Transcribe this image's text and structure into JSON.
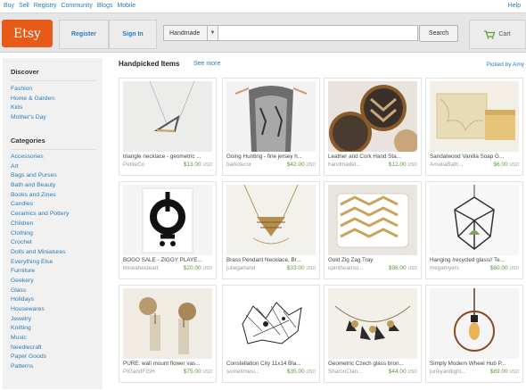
{
  "topnav": {
    "items": [
      "Buy",
      "Sell",
      "Registry",
      "Community",
      "Blogs",
      "Mobile"
    ],
    "help": "Help"
  },
  "header": {
    "logo": "Etsy",
    "register": "Register",
    "signin": "Sign In",
    "search": {
      "category": "Handmade",
      "value": "",
      "button": "Search"
    },
    "cart": "Cart",
    "colors": {
      "logo": "#e55b17",
      "link": "#2b7bb9",
      "price": "#5c9b3a"
    }
  },
  "sidebar": {
    "discover_title": "Discover",
    "discover": [
      "Fashion",
      "Home & Garden",
      "Kids",
      "Mother's Day"
    ],
    "categories_title": "Categories",
    "categories": [
      "Accessories",
      "Art",
      "Bags and Purses",
      "Bath and Beauty",
      "Books and Zines",
      "Candles",
      "Ceramics and Pottery",
      "Children",
      "Clothing",
      "Crochet",
      "Dolls and Miniatures",
      "Everything Else",
      "Furniture",
      "Geekery",
      "Glass",
      "Holidays",
      "Housewares",
      "Jewelry",
      "Knitting",
      "Music",
      "Needlecraft",
      "Paper Goods",
      "Patterns"
    ]
  },
  "main": {
    "title": "Handpicked Items",
    "see_more": "See more",
    "picked_by": "Picked by Amy",
    "items": [
      {
        "title": "triangle necklace - geometric ...",
        "shop": "PetiteCo",
        "price": "$13.00",
        "currency": "USD",
        "icon": "triangle-necklace"
      },
      {
        "title": "Going Hunting - fine jersey h...",
        "shop": "barkdecor",
        "price": "$42.00",
        "currency": "USD",
        "icon": "scarf"
      },
      {
        "title": "Leather and Cork Hand Sta...",
        "shop": "handmadet...",
        "price": "$12.00",
        "currency": "USD",
        "icon": "coasters"
      },
      {
        "title": "Sandalwood Vanilla Soap G...",
        "shop": "AmeliaBath...",
        "price": "$6.00",
        "currency": "USD",
        "icon": "soap"
      },
      {
        "title": "BOGO SALE - ZIGGY PLAYE...",
        "shop": "linneaheideart",
        "price": "$20.00",
        "currency": "USD",
        "icon": "bike-print"
      },
      {
        "title": "Brass Pendant Necklace, Br...",
        "shop": "juliegarland",
        "price": "$33.00",
        "currency": "USD",
        "icon": "brass-necklace"
      },
      {
        "title": "Gold Zig Zag Tray",
        "shop": "upintheairso...",
        "price": "$98.00",
        "currency": "USD",
        "icon": "zigzag-tray"
      },
      {
        "title": "Hanging /recycled glass// Te...",
        "shop": "megamyers",
        "price": "$60.00",
        "currency": "USD",
        "icon": "terrarium"
      },
      {
        "title": "PURE: wall mount flower vas...",
        "shop": "PIGandFISH",
        "price": "$75.00",
        "currency": "USD",
        "icon": "flower-vase"
      },
      {
        "title": "Constellation City 11x14 Bla...",
        "shop": "sometimesi...",
        "price": "$35.00",
        "currency": "USD",
        "icon": "city-print"
      },
      {
        "title": "Geometric Czech glass bron...",
        "shop": "SharonClan...",
        "price": "$44.00",
        "currency": "USD",
        "icon": "glass-necklace"
      },
      {
        "title": "Simply Modern Wheel Hub P...",
        "shop": "junkyardlight...",
        "price": "$89.00",
        "currency": "USD",
        "icon": "pendant-lamp"
      }
    ]
  }
}
